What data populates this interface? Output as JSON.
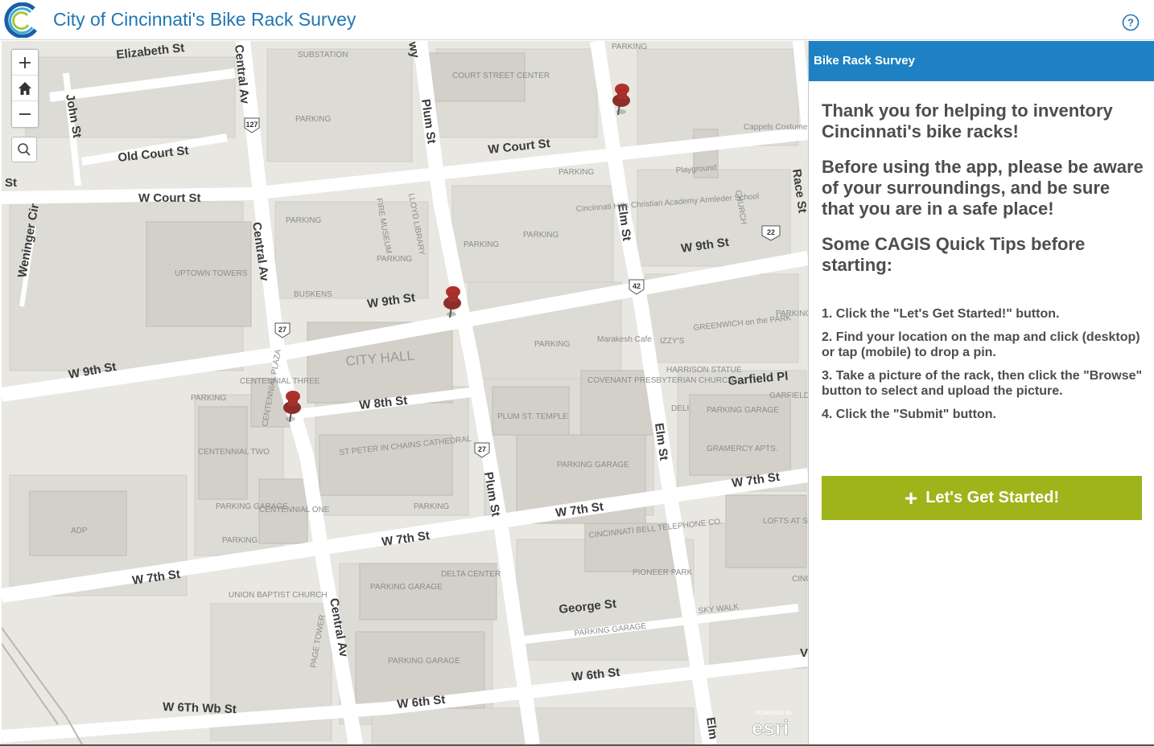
{
  "header": {
    "title": "City of Cincinnati's Bike Rack Survey",
    "help_icon": "help-circle-icon",
    "logo_icon": "city-logo-icon"
  },
  "map": {
    "controls": {
      "zoom_in_icon": "plus-icon",
      "home_icon": "home-icon",
      "zoom_out_icon": "minus-icon",
      "search_icon": "search-icon"
    },
    "pin_icon": "pushpin-icon",
    "pin_count": 3,
    "streets": {
      "elizabeth": "Elizabeth St",
      "john": "John St",
      "central1": "Central Av",
      "central2": "Central Av",
      "central3": "Central Av",
      "old_court": "Old Court St",
      "w_court1": "W Court St",
      "w_court2": "W Court St",
      "st_left": "St",
      "weninger": "Weninger Cir",
      "plum1": "Plum St",
      "plum2": "Plum St",
      "elm1": "Elm St",
      "elm2": "Elm St",
      "elm3": "Elm",
      "race": "Race St",
      "w9th1": "W 9th St",
      "w9th2": "W 9th St",
      "w9th3": "W 9th St",
      "w8th": "W 8th St",
      "garfield": "Garfield Pl",
      "w7th1": "W 7th St",
      "w7th2": "W 7th St",
      "w7th3": "W 7th St",
      "w7th4": "W 7th St",
      "george": "George St",
      "w6th1": "W 6th St",
      "w6th2": "W 6th St",
      "w6thwb": "W 6Th Wb St",
      "way": "wy",
      "v": "V"
    },
    "pois": {
      "court_street_center": "COURT STREET CENTER",
      "parking": "PARKING",
      "substation": "SUBSTATION",
      "uptown_towers": "UPTOWN TOWERS",
      "buskens": "BUSKENS",
      "city_hall": "CITY HALL",
      "centennial_three": "CENTENNIAL THREE",
      "centennial_two": "CENTENNIAL TWO",
      "centennial_plaza": "CENTENNIAL PLAZA",
      "centennial_one": "CENTENNIAL ONE",
      "parking_garage": "PARKING GARAGE",
      "st_peter": "ST PETER IN CHAINS CATHEDRAL",
      "plum_st_temple": "PLUM ST. TEMPLE",
      "covenant": "COVENANT PRESBYTERIAN CHURCH",
      "cincinnati_bell": "CINCINNATI BELL TELEPHONE CO.",
      "pioneer_park": "PIONEER PARK",
      "delta_center": "DELTA CENTER",
      "union_baptist": "UNION BAPTIST CHURCH",
      "page_tower": "PAGE TOWER",
      "adp": "ADP",
      "harrison_statue": "HARRISON STATUE",
      "greenwich": "GREENWICH on the PARK",
      "izzys": "IZZY'S",
      "deli": "DELI",
      "gramercy": "GRAMERCY APTS.",
      "garfield_tower": "GARFIELD TOWER",
      "lofts": "LOFTS AT SHILLITO PL",
      "playground": "Playground",
      "cappels": "Cappels Costume Store",
      "church": "CHURCH",
      "fire_museum": "FIRE MUSEUM",
      "lloyd_library": "LLOYD LIBRARY",
      "academy": "Cincinnati Hills Christian Academy Armleder School",
      "marakesh": "Marakesh Cafe",
      "sky_walk": "SKY WALK",
      "cinc_athl": "CINC ATHL CL",
      "esri_powered": "POWERED BY",
      "esri": "esri"
    },
    "highways": [
      "127",
      "27",
      "27",
      "42",
      "22"
    ]
  },
  "panel": {
    "title": "Bike Rack Survey",
    "heading1": "Thank you for helping to inventory Cincinnati's bike racks!",
    "heading2": "Before using the app, please be aware of your surroundings, and be sure that you are in a safe place!",
    "heading3": "Some CAGIS Quick Tips before starting:",
    "tips": [
      "1. Click the \"Let's Get Started!\" button.",
      "2. Find your location on the map and click (desktop) or tap (mobile) to drop a pin.",
      "3. Take a picture of the rack, then click the \"Browse\" button to select and upload the picture.",
      "4. Click the \"Submit\" button."
    ],
    "start_button": "Let's Get Started!",
    "start_icon": "plus-icon"
  },
  "colors": {
    "title_blue": "#2077b4",
    "panel_header": "#1d81c3",
    "start_green": "#9fb31b",
    "map_bg": "#e8e7e2",
    "pin_red": "#b0322a"
  }
}
